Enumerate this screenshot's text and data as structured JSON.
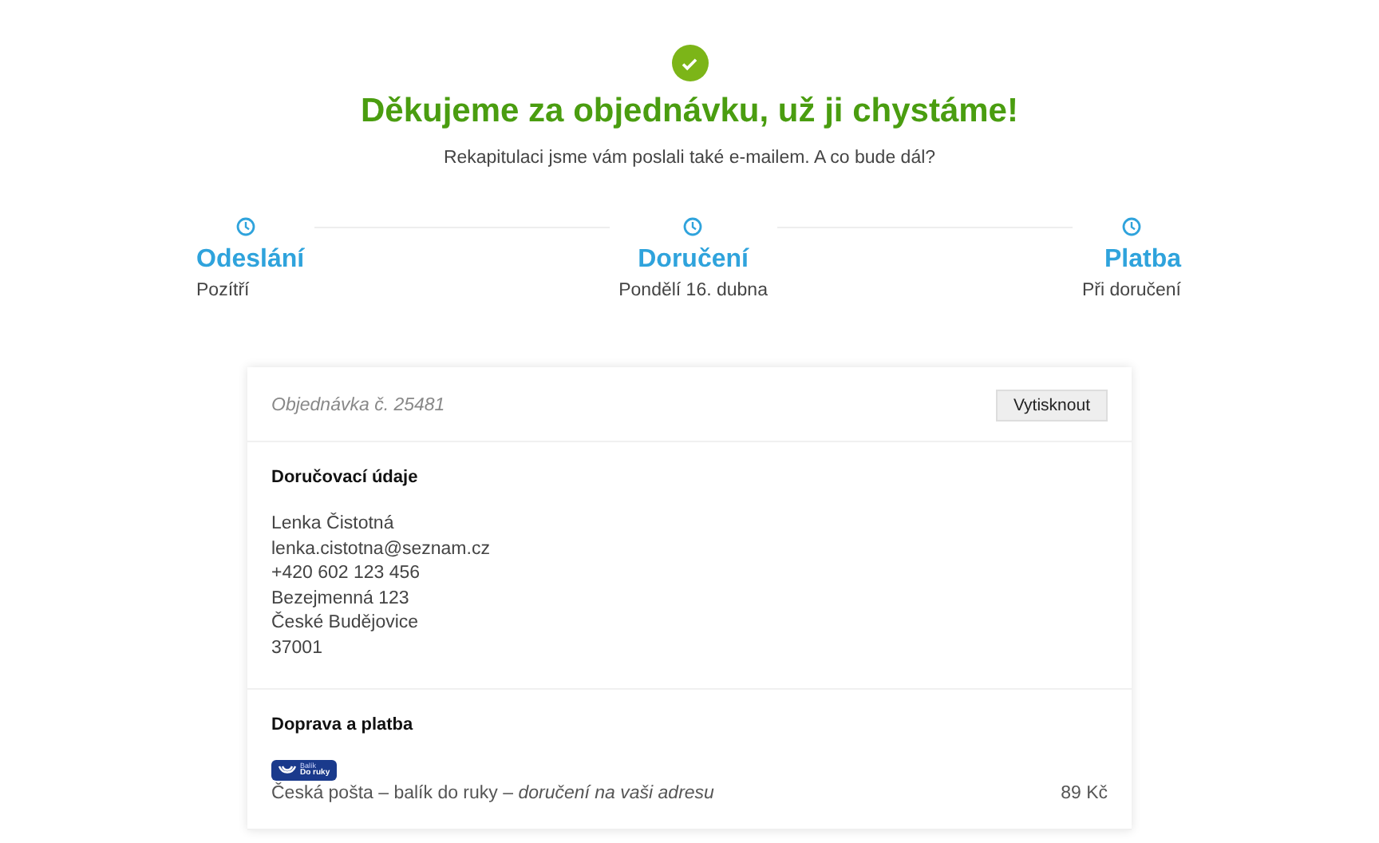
{
  "heading": {
    "title": "Děkujeme za objednávku, už ji chystáme!",
    "subtitle": "Rekapitulaci jsme vám poslali také e-mailem. A co bude dál?"
  },
  "steps": [
    {
      "label": "Odeslání",
      "value": "Pozítří"
    },
    {
      "label": "Doručení",
      "value": "Pondělí 16. dubna"
    },
    {
      "label": "Platba",
      "value": "Při doručení"
    }
  ],
  "order": {
    "number": "Objednávka č. 25481",
    "print_button": "Vytisknout",
    "delivery": {
      "title": "Doručovací údaje",
      "lines": [
        "Lenka Čistotná",
        "lenka.cistotna@seznam.cz",
        "+420 602 123 456",
        "Bezejmenná 123",
        "České Budějovice",
        "37001"
      ]
    },
    "shipping": {
      "title": "Doprava a platba",
      "logo_lines": [
        "Balík",
        "Do ruky"
      ],
      "description": "Česká pošta – balík do ruky – *doručení na vaši adresu*",
      "price": "89 Kč"
    }
  }
}
